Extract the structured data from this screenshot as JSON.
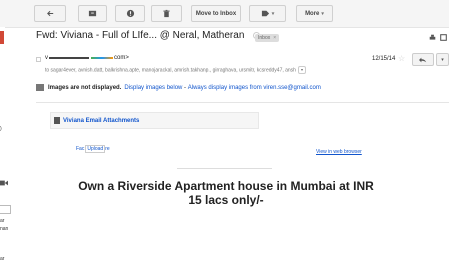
{
  "toolbar": {
    "move_to_inbox_label": "Move to Inbox",
    "more_label": "More"
  },
  "left_fragments": {
    "paren": ")",
    "text1": "ar",
    "text2": "nan",
    "text3": "ar"
  },
  "email": {
    "subject": "Fwd: Viviana - Full of LIfe... @ Neral, Matheran",
    "label": "Inbox",
    "sender_prefix": "v",
    "sender_suffix": "com>",
    "date": "12/15/14",
    "recipients": "to sagar4ever, avnish.datt, balkrishna.apte, manojarackal, amrish.takhanp., girraghava, ursmitr, kcsreddy47, ansh"
  },
  "images_notice": {
    "bold": "Images are not displayed.",
    "link1": "Display images below",
    "separator": " - ",
    "link2": "Always display images from viren.sse@gmail.com"
  },
  "attachment": {
    "title": "Viviana Email Attachments"
  },
  "body": {
    "link_row_prefix": "Fac",
    "link_row_boxes": "Upload",
    "link_row_suffix": "re",
    "view_web": "View in web browser",
    "headline": "Own a Riverside Apartment house in Mumbai at INR 15 lacs only/-"
  }
}
